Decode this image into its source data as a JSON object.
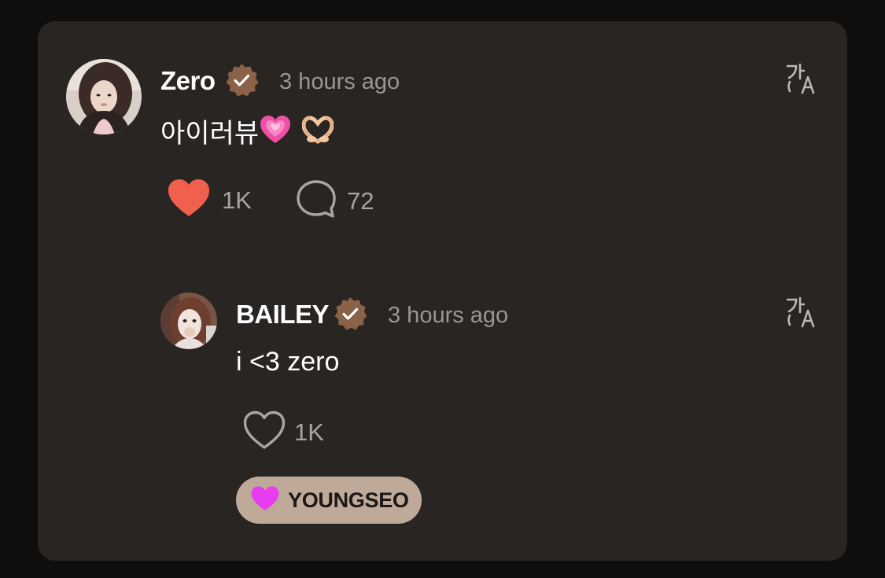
{
  "comment": {
    "author": "Zero",
    "verified": true,
    "timestamp": "3 hours ago",
    "text_prefix": "아이러뷰",
    "emojis": [
      "growing-heart",
      "heart-hands"
    ],
    "likes": "1K",
    "liked": true,
    "replies": "72",
    "translate_icon": "translate-icon"
  },
  "reply": {
    "author": "BAILEY",
    "verified": true,
    "timestamp": "3 hours ago",
    "text": "i <3 zero",
    "likes": "1K",
    "liked": false,
    "translate_icon": "translate-icon",
    "tag_label": "YOUNGSEO"
  },
  "colors": {
    "background": "#0f0e0d",
    "card": "#282523",
    "verified_badge": "#8a6248",
    "heart_liked": "#f0604d",
    "tag_heart": "#e83cf0",
    "tag_background": "#bfaa9a"
  }
}
